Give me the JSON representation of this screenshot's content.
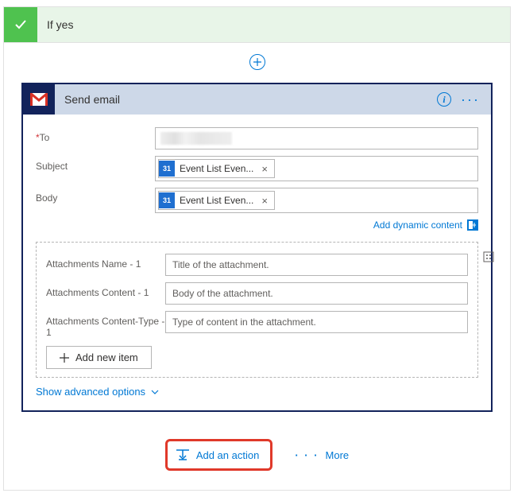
{
  "condition": {
    "title": "If yes"
  },
  "action": {
    "title": "Send email",
    "fields": {
      "to": {
        "label": "To",
        "required": "*"
      },
      "subject": {
        "label": "Subject",
        "token": "Event List Even..."
      },
      "body": {
        "label": "Body",
        "token": "Event List Even..."
      }
    },
    "dynamic_content_label": "Add dynamic content",
    "attachments": {
      "name": {
        "label": "Attachments Name - 1",
        "placeholder": "Title of the attachment."
      },
      "content": {
        "label": "Attachments Content - 1",
        "placeholder": "Body of the attachment."
      },
      "content_type": {
        "label": "Attachments Content-Type - 1",
        "placeholder": "Type of content in the attachment."
      }
    },
    "add_new_item": "Add new item",
    "advanced_options": "Show advanced options"
  },
  "footer": {
    "add_action": "Add an action",
    "more": "More"
  },
  "calendar_day": "31"
}
